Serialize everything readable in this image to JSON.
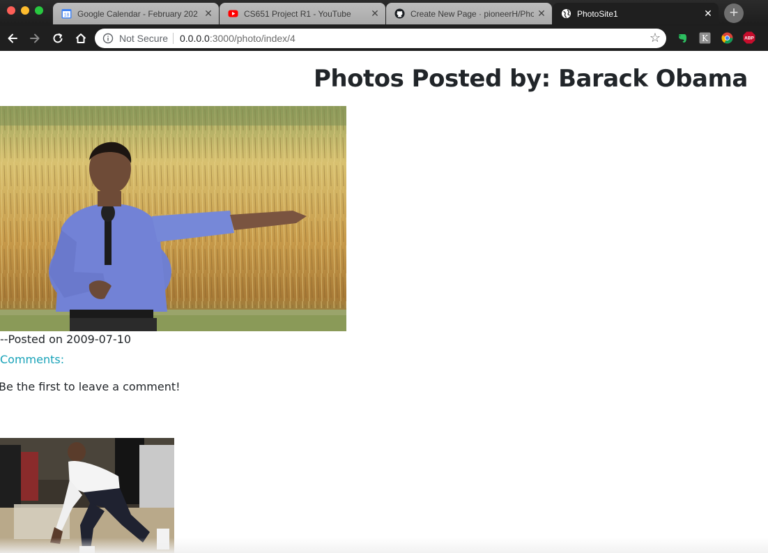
{
  "browser": {
    "tabs": [
      {
        "title": "Google Calendar - February 202",
        "favicon": "calendar-icon",
        "favicon_label": "18",
        "active": false
      },
      {
        "title": "CS651 Project R1 - YouTube",
        "favicon": "youtube-icon",
        "active": false
      },
      {
        "title": "Create New Page · pioneerH/Pho",
        "favicon": "github-icon",
        "active": false
      },
      {
        "title": "PhotoSite1",
        "favicon": "globe-icon",
        "active": true
      }
    ],
    "close_glyph": "✕",
    "new_tab_glyph": "+",
    "security_label": "Not Secure",
    "url_host": "0.0.0.0",
    "url_path": ":3000/photo/index/4",
    "extensions": [
      "evernote-icon",
      "k-extension-icon",
      "chrome-extension-icon",
      "adblock-plus-icon"
    ],
    "adblock_label": "ABP",
    "k_label": "K"
  },
  "page": {
    "heading": "Photos Posted by: Barack Obama",
    "posts": [
      {
        "posted_text": "--Posted on 2009-07-10",
        "comments_label": "Comments:",
        "no_comments_text": "Be the first to leave a comment!"
      }
    ]
  },
  "colors": {
    "comments_accent": "#17a2b8",
    "text": "#212529",
    "chrome_dark": "#1f1f1f"
  }
}
